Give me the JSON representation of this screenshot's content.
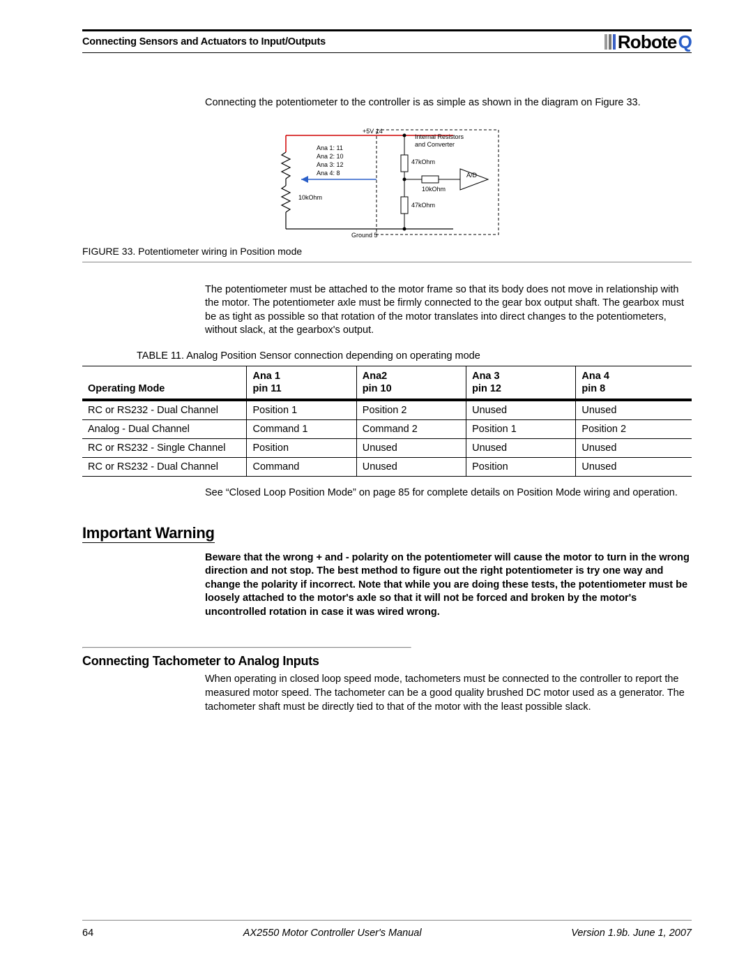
{
  "header": {
    "title": "Connecting Sensors and Actuators to Input/Outputs",
    "logo_text": "Robote",
    "logo_q": "Q"
  },
  "intro_para": "Connecting the potentiometer to the controller is as simple as shown in the diagram on Figure 33.",
  "figure": {
    "top_label": "+5V  14",
    "resistors_label_1": "Internal Resistors",
    "resistors_label_2": "and Converter",
    "ana1": "Ana 1:   11",
    "ana2": "Ana 2:   10",
    "ana3": "Ana 3:   12",
    "ana4": "Ana 4:     8",
    "r47a": "47kOhm",
    "r47b": "47kOhm",
    "r10a": "10kOhm",
    "r10b": "10kOhm",
    "ad": "A/D",
    "ground": "Ground   5",
    "caption": "FIGURE 33.  Potentiometer wiring in Position mode"
  },
  "para2": "The potentiometer must be attached to the motor frame so that its body does not move in relationship with the motor. The potentiometer axle must be firmly connected to the gear box output shaft. The gearbox must be as tight as possible so that rotation of the motor translates into direct changes to the potentiometers, without slack, at the gearbox's output.",
  "table": {
    "caption": "TABLE 11. Analog Position Sensor connection depending on operating mode",
    "headers": {
      "c0": "Operating Mode",
      "c1a": "Ana 1",
      "c1b": "pin 11",
      "c2a": "Ana2",
      "c2b": "pin 10",
      "c3a": "Ana 3",
      "c3b": "pin 12",
      "c4a": "Ana 4",
      "c4b": "pin 8"
    },
    "rows": [
      [
        "RC or RS232 - Dual Channel",
        "Position 1",
        "Position 2",
        "Unused",
        "Unused"
      ],
      [
        "Analog - Dual Channel",
        "Command 1",
        "Command 2",
        "Position 1",
        "Position 2"
      ],
      [
        "RC or RS232 - Single Channel",
        "Position",
        "Unused",
        "Unused",
        "Unused"
      ],
      [
        "RC or RS232 - Dual Channel",
        "Command",
        "Unused",
        "Position",
        "Unused"
      ]
    ]
  },
  "para3": "See “Closed Loop Position Mode” on page 85 for complete details on Position Mode wiring and operation.",
  "warning": {
    "heading": "Important Warning",
    "body": "Beware that the wrong + and - polarity on the potentiometer will cause the motor to turn in the wrong direction and not stop. The best method to figure out the right potentiometer is try one way and change the polarity if incorrect. Note that while you are doing these tests, the potentiometer must be loosely attached to the motor's axle so that it will not be forced and broken by the motor's uncontrolled rotation in case it was wired wrong."
  },
  "section": {
    "heading": "Connecting Tachometer to Analog Inputs",
    "body": "When operating in closed loop speed mode, tachometers must be connected to the controller to report the measured motor speed. The tachometer can be a good quality brushed DC motor used as a generator. The tachometer shaft must be directly tied to that of the motor with the least possible slack."
  },
  "footer": {
    "page": "64",
    "center": "AX2550 Motor Controller User's Manual",
    "right": "Version 1.9b. June 1, 2007"
  }
}
